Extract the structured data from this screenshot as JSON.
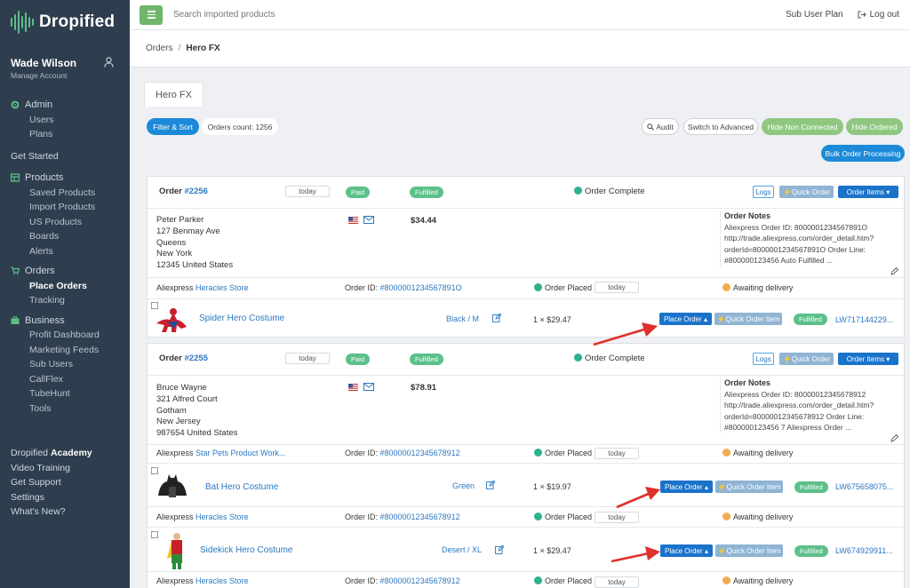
{
  "app": {
    "name": "Dropified"
  },
  "user": {
    "name": "Wade Wilson",
    "manage": "Manage Account"
  },
  "sidebar": {
    "admin": {
      "label": "Admin",
      "items": [
        "Users",
        "Plans"
      ]
    },
    "get_started": "Get Started",
    "products": {
      "label": "Products",
      "items": [
        "Saved Products",
        "Import Products",
        "US Products",
        "Boards",
        "Alerts"
      ]
    },
    "orders": {
      "label": "Orders",
      "items": [
        "Place Orders",
        "Tracking"
      ]
    },
    "business": {
      "label": "Business",
      "items": [
        "Profit Dashboard",
        "Marketing Feeds",
        "Sub Users",
        "CallFlex",
        "TubeHunt",
        "Tools"
      ]
    },
    "academy_prefix": "Dropified ",
    "academy_bold": "Academy",
    "bottom": [
      "Video Training",
      "Get Support",
      "Settings",
      "What's New?"
    ]
  },
  "topbar": {
    "search_placeholder": "Search imported products",
    "plan": "Sub User Plan",
    "logout": "Log out"
  },
  "breadcrumb": {
    "root": "Orders",
    "sep": "/",
    "current": "Hero FX"
  },
  "store_tab": "Hero FX",
  "controls": {
    "filter": "Filter & Sort",
    "count": "Orders count: 1256",
    "audit": "Audit",
    "switch": "Switch to Advanced",
    "hide_non_connected": "Hide Non Connected",
    "hide_ordered": "Hide Ordered",
    "bulk": "Bulk Order Processing"
  },
  "orders": [
    {
      "label": "Order ",
      "number": "#2256",
      "date": "today",
      "paid": "Paid",
      "fulfilled": "Fulfilled",
      "status": "Order Complete",
      "logs": "Logs",
      "quick_order": "Quick Order",
      "order_items": "Order Items",
      "address": [
        "Peter Parker",
        "127 Benmay Ave",
        "Queens",
        "New York",
        "12345 United States"
      ],
      "total": "$34.44",
      "notes_title": "Order Notes",
      "notes": [
        "Aliexpress Order ID: 8000001234567891O",
        "http://trade.aliexpress.com/order_detail.htm?",
        "orderId=8000001234567891O Order Line:",
        "#800000123456  Auto Fulfilled ..."
      ],
      "lines": [
        {
          "supplier_prefix": "Aliexpress ",
          "supplier": "Heracles Store",
          "order_id_label": "Order ID: ",
          "order_id": "#8000001234567891O",
          "placed": "Order Placed",
          "placed_date": "today",
          "shipping": "Awaiting delivery",
          "product": "Spider Hero Costume",
          "variant": "Black / M",
          "qty_price": "1 × $29.47",
          "place_order": "Place Order",
          "quick_order_item": "Quick Order Item",
          "fulfilled": "Fulfilled",
          "tracking": "LW717144229..."
        }
      ]
    },
    {
      "label": "Order ",
      "number": "#2255",
      "date": "today",
      "paid": "Paid",
      "fulfilled": "Fulfilled",
      "status": "Order Complete",
      "logs": "Logs",
      "quick_order": "Quick Order",
      "order_items": "Order Items",
      "address": [
        "Bruce Wayne",
        "321 Alfred Court",
        "Gotham",
        "New Jersey",
        "987654 United States"
      ],
      "total": "$78.91",
      "notes_title": "Order Notes",
      "notes": [
        "Aliexpress Order ID: 80000012345678912",
        "http://trade.aliexpress.com/order_detail.htm?",
        "orderId=80000012345678912 Order Line:",
        "#800000123456 7  Aliexpress Order ..."
      ],
      "lines": [
        {
          "supplier_prefix": "Aliexpress ",
          "supplier": "Star Pets Product Work...",
          "order_id_label": "Order ID: ",
          "order_id": "#80000012345678912",
          "placed": "Order Placed",
          "placed_date": "today",
          "shipping": "Awaiting delivery",
          "product": "Bat Hero Costume",
          "variant": "Green",
          "qty_price": "1 × $19.97",
          "place_order": "Place Order",
          "quick_order_item": "Quick Order Item",
          "fulfilled": "Fulfilled",
          "tracking": "LW675658075..."
        },
        {
          "supplier_prefix": "Aliexpress ",
          "supplier": "Heracles Store",
          "order_id_label": "Order ID: ",
          "order_id": "#80000012345678912",
          "placed": "Order Placed",
          "placed_date": "today",
          "shipping": "Awaiting delivery",
          "product": "Sidekick Hero Costume",
          "variant": "Desert / XL",
          "qty_price": "1 × $29.47",
          "place_order": "Place Order",
          "quick_order_item": "Quick Order Item",
          "fulfilled": "Fulfilled",
          "tracking": "LW674929911..."
        },
        {
          "supplier_prefix": "Aliexpress ",
          "supplier": "Heracles Store",
          "order_id_label": "Order ID: ",
          "order_id": "#80000012345678912",
          "placed": "Order Placed",
          "placed_date": "today",
          "shipping": "Awaiting delivery"
        }
      ]
    }
  ],
  "colors": {
    "sidebar": "#2f3e4e",
    "accent_blue": "#1a73c9",
    "green": "#5cc08a",
    "arrow": "#e0302b"
  },
  "icons": {
    "logo": "sound-bars-icon",
    "user": "user-icon",
    "menu": "hamburger-icon",
    "logout": "sign-out-icon",
    "audit": "magnifier-icon",
    "flag": "us-flag-icon",
    "email": "envelope-icon",
    "edit": "edit-icon"
  }
}
